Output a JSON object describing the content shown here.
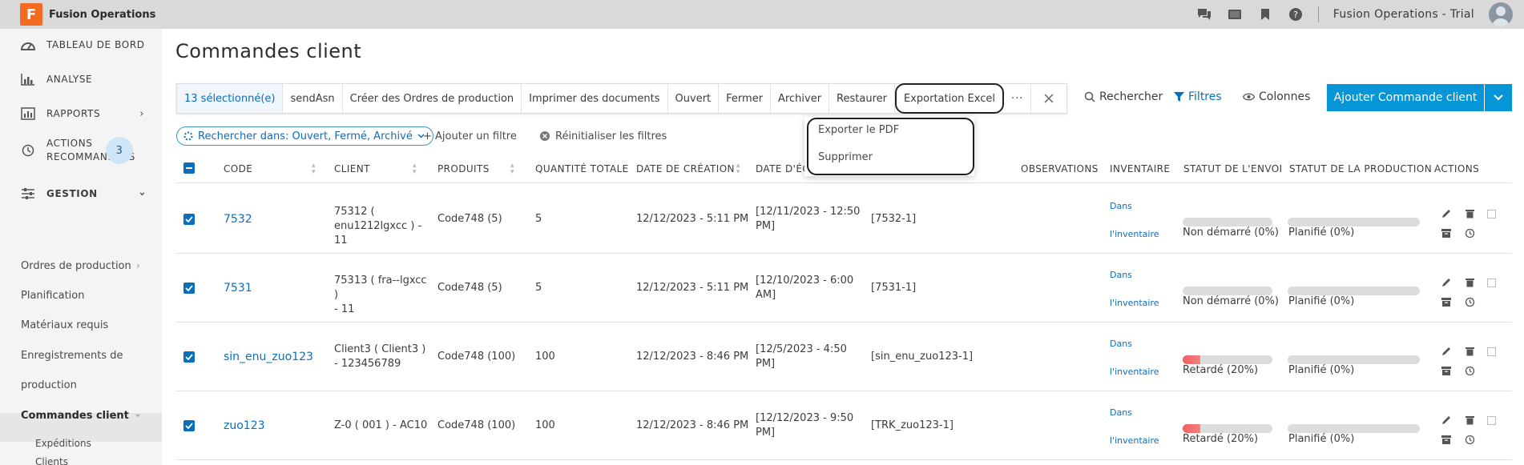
{
  "app": {
    "logo_letter": "F",
    "name": "Fusion Operations",
    "account": "Fusion Operations - Trial"
  },
  "topbar_icons": [
    "chat-icon",
    "video-icon",
    "bookmark-icon",
    "help-icon"
  ],
  "sidebar": {
    "items": [
      {
        "label": "TABLEAU DE BORD",
        "icon": "dashboard-icon"
      },
      {
        "label": "ANALYSE",
        "icon": "chart-icon"
      },
      {
        "label": "RAPPORTS",
        "icon": "report-icon"
      },
      {
        "label_line1": "ACTIONS",
        "label_line2": "RECOMMANDÉES",
        "icon": "history-icon",
        "badge": "3"
      },
      {
        "label": "GESTION",
        "icon": "sliders-icon"
      }
    ],
    "sub_items": {
      "ordres": "Ordres de production",
      "planification": "Planification",
      "materiaux": "Matériaux requis",
      "enreg_line1": "Enregistrements de",
      "enreg_line2": "production",
      "commandes": "Commandes client",
      "expeditions": "Expéditions",
      "clients": "Clients"
    }
  },
  "page": {
    "title": "Commandes client"
  },
  "toolbar": {
    "selected": "13 sélectionné(e)",
    "buttons": [
      "sendAsn",
      "Créer des Ordres de production",
      "Imprimer des documents",
      "Ouvert",
      "Fermer",
      "Archiver",
      "Restaurer",
      "Exportation Excel"
    ],
    "more": "···"
  },
  "right_tools": {
    "search": "Rechercher",
    "filters": "Filtres",
    "columns": "Colonnes"
  },
  "add_button": "Ajouter Commande client",
  "dropdown": {
    "items": [
      "Exporter le PDF",
      "Supprimer"
    ]
  },
  "filters": {
    "chip": "Rechercher dans: Ouvert, Fermé, Archivé",
    "add": "+ Ajouter un filtre",
    "reset": "Réinitialiser les filtres"
  },
  "table": {
    "headers": [
      "CODE",
      "CLIENT",
      "PRODUITS",
      "QUANTITÉ TOTALE",
      "DATE DE CRÉATION",
      "DATE D'ÉC",
      "OBSERVATIONS",
      "INVENTAIRE",
      "STATUT DE L'ENVOI",
      "STATUT DE LA PRODUCTION",
      "ACTIONS"
    ],
    "rows": [
      {
        "code": "7532",
        "client_l1": "75312 (",
        "client_l2": "enu1212lgxcc ) - 11",
        "produits": "Code748 (5)",
        "quantite": "5",
        "creation": "12/12/2023 - 5:11 PM",
        "echeance_l1": "[12/11/2023 - 12:50",
        "echeance_l2": "PM]",
        "ref": "[7532-1]",
        "inv_l1": "Dans",
        "inv_l2": "l'inventaire",
        "envoi": "Non démarré (0%)",
        "envoi_pct": 0,
        "prod": "Planifié (0%)",
        "prod_pct": 0
      },
      {
        "code": "7531",
        "client_l1": "75313 ( fra--lgxcc )",
        "client_l2": "- 11",
        "produits": "Code748 (5)",
        "quantite": "5",
        "creation": "12/12/2023 - 5:11 PM",
        "echeance_l1": "[12/10/2023 - 6:00",
        "echeance_l2": "AM]",
        "ref": "[7531-1]",
        "inv_l1": "Dans",
        "inv_l2": "l'inventaire",
        "envoi": "Non démarré (0%)",
        "envoi_pct": 0,
        "prod": "Planifié (0%)",
        "prod_pct": 0
      },
      {
        "code": "sin_enu_zuo123",
        "client_l1": "Client3 ( Client3 )",
        "client_l2": "- 123456789",
        "produits": "Code748 (100)",
        "quantite": "100",
        "creation": "12/12/2023 - 8:46 PM",
        "echeance_l1": "[12/5/2023 - 4:50",
        "echeance_l2": "PM]",
        "ref": "[sin_enu_zuo123-1]",
        "inv_l1": "Dans",
        "inv_l2": "l'inventaire",
        "envoi": "Retardé (20%)",
        "envoi_pct": 20,
        "prod": "Planifié (0%)",
        "prod_pct": 0
      },
      {
        "code": "zuo123",
        "client_l1": "Z-0 ( 001 ) - AC10",
        "client_l2": "",
        "produits": "Code748 (100)",
        "quantite": "100",
        "creation": "12/12/2023 - 8:46 PM",
        "echeance_l1": "[12/12/2023 - 9:50",
        "echeance_l2": "PM]",
        "ref": "[TRK_zuo123-1]",
        "inv_l1": "Dans",
        "inv_l2": "l'inventaire",
        "envoi": "Retardé (20%)",
        "envoi_pct": 20,
        "prod": "Planifié (0%)",
        "prod_pct": 0
      }
    ]
  },
  "colors": {
    "accent": "#0696d7",
    "link": "#0a6ebd",
    "brand": "#f26b21",
    "delayed": "#f26060"
  }
}
